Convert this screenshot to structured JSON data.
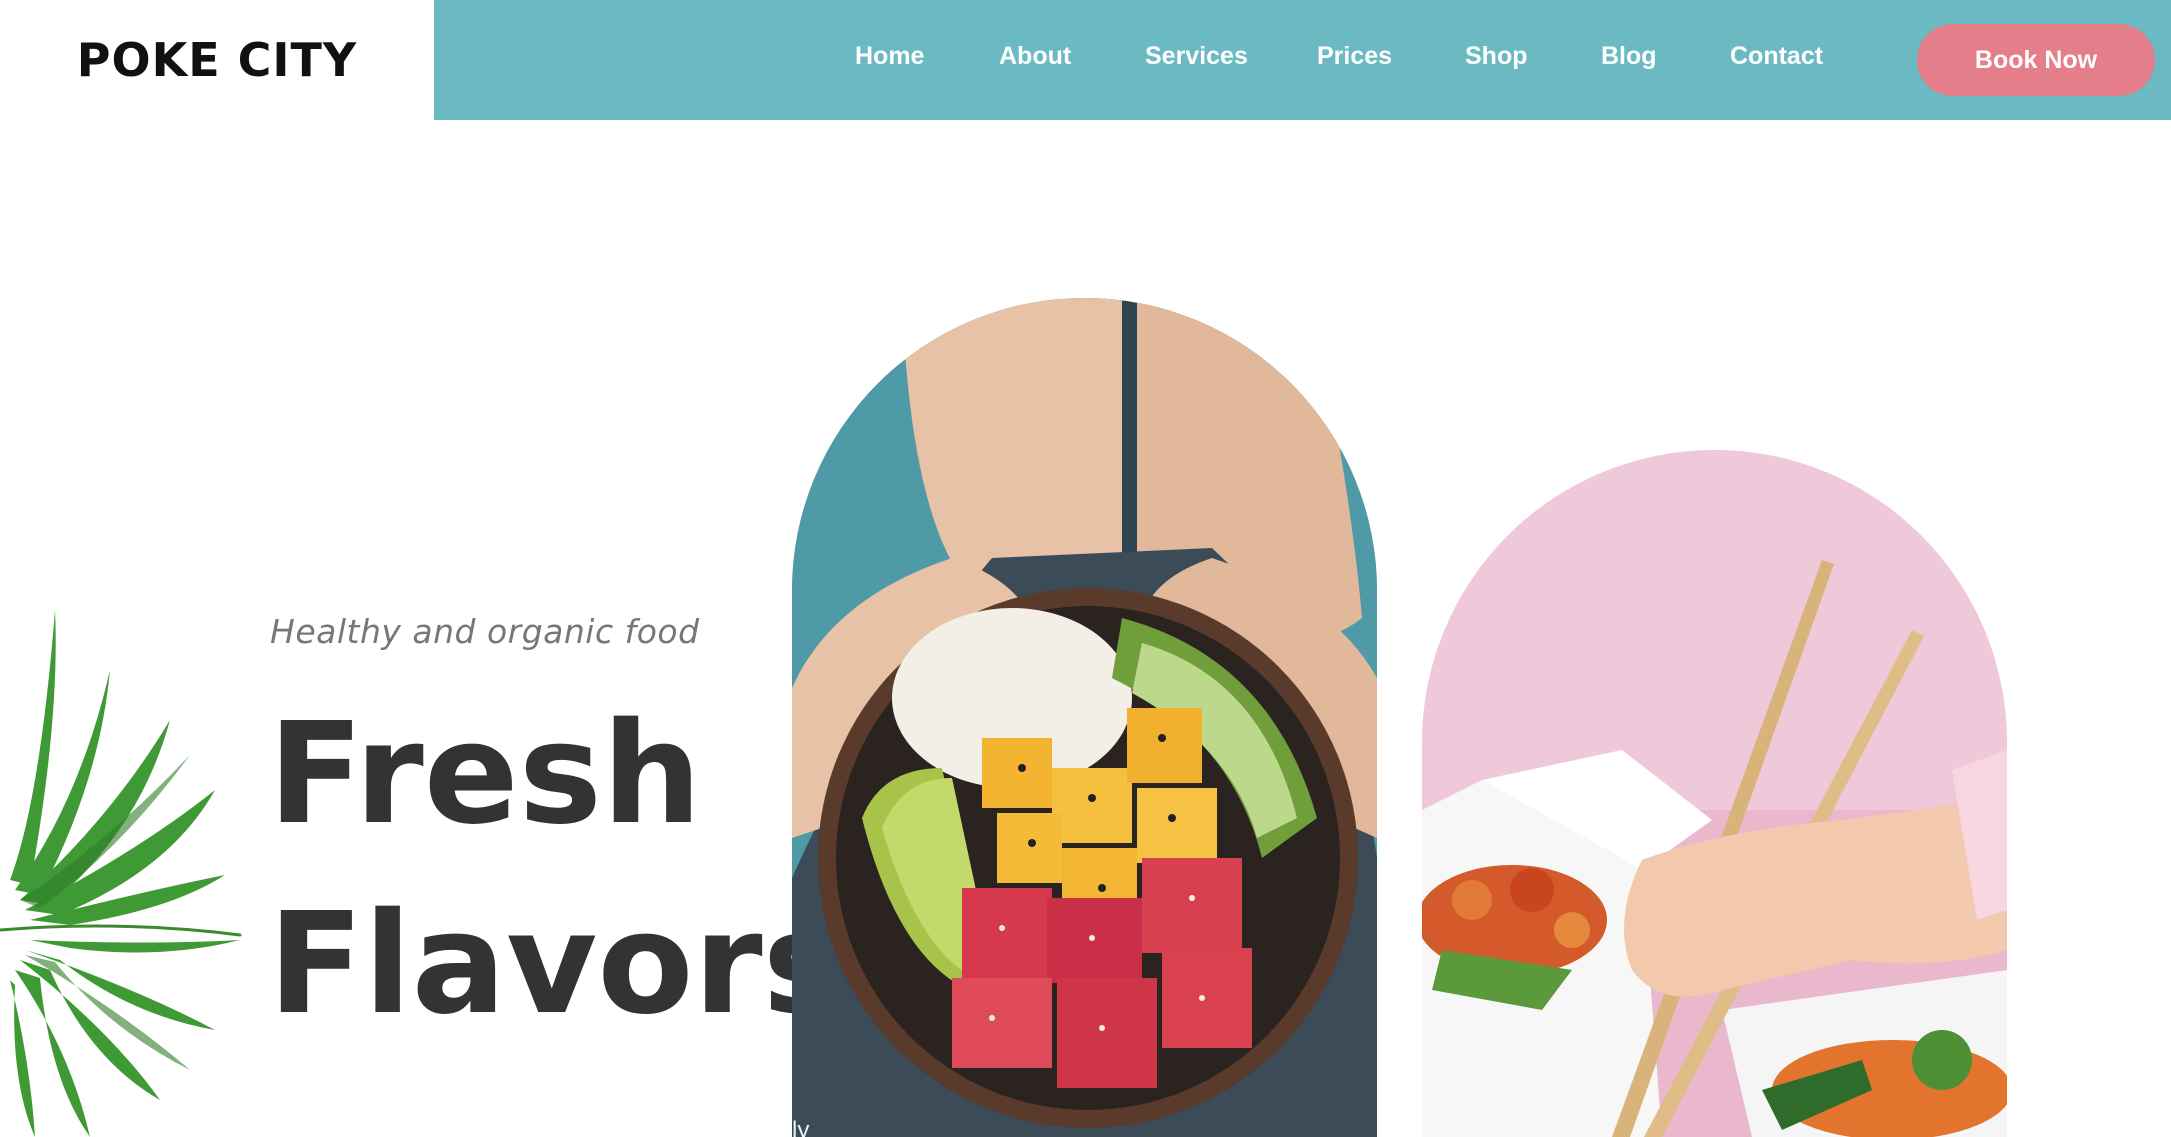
{
  "brand": {
    "logo_text": "POKE CITY"
  },
  "nav": {
    "items": [
      {
        "label": "Home"
      },
      {
        "label": "About"
      },
      {
        "label": "Services"
      },
      {
        "label": "Prices"
      },
      {
        "label": "Shop"
      },
      {
        "label": "Blog"
      },
      {
        "label": "Contact"
      }
    ],
    "cta_label": "Book Now"
  },
  "hero": {
    "tagline": "Healthy and organic food",
    "headline_line1": "Fresh",
    "headline_line2": "Flavors",
    "image1_caption_fragment": "ly"
  },
  "colors": {
    "nav_bg": "#6bb9c3",
    "cta_bg": "#e47e8a",
    "headline": "#333333",
    "arch1_bg": "#4e9aa6",
    "arch2_bg": "#efc8d9"
  },
  "images": {
    "arch1": "poke-bowl-in-hands-photo",
    "arch2": "chopsticks-takeout-food-photo",
    "decor": "palm-leaf-decoration"
  }
}
